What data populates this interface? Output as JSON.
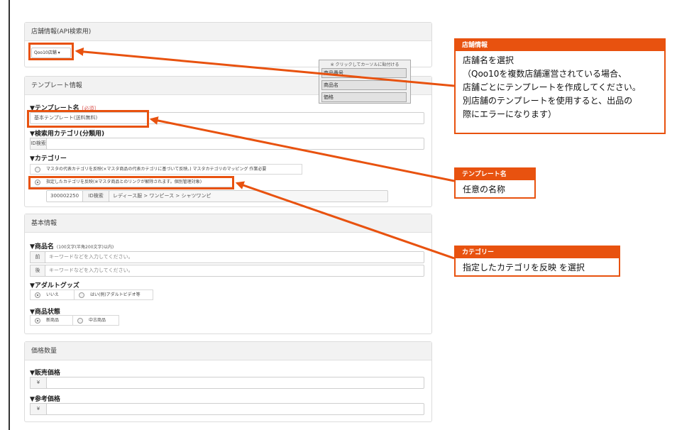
{
  "store_panel": {
    "title": "店舗情報(API検索用)",
    "store_dropdown": "Qoo10店舗 ▾"
  },
  "insert_popup": {
    "note": "※ クリックしてカーソルに貼付ける",
    "items": [
      "商品番号",
      "商品名",
      "価格"
    ]
  },
  "template_panel": {
    "title": "テンプレート情報",
    "template_name_label": "▼テンプレート名",
    "required": "[必須]",
    "template_name_value": "基本テンプレート(送料無料)",
    "search_category_label": "▼検索用カテゴリ(分類用)",
    "id_search": "ID検索",
    "category_label": "▼カテゴリー",
    "category_option_master": "マスタの代表カテゴリを反映(×マスタ商品の代表カテゴリに基づいて反映。) マスタカテゴリのマッピング 作業必要",
    "category_option_specified": "指定したカテゴリを反映(※マスタ商品とのリンクが解除されます。個別管理対象)",
    "category_id": "300002250",
    "category_id_search": "ID検索",
    "category_path": "レディース服 > ワンピース > シャツワンピ"
  },
  "basic_panel": {
    "title": "基本情報",
    "product_name_label": "▼商品名",
    "product_name_hint": "(100文字(半角200文字)以内)",
    "prefix_label": "前",
    "suffix_label": "後",
    "keyword_placeholder": "キーワードなどを入力してください。",
    "adult_label": "▼アダルトグッズ",
    "adult_no": "いいえ",
    "adult_yes": "はい(例)アダルトビデオ等",
    "condition_label": "▼商品状態",
    "condition_new": "新商品",
    "condition_used": "中古商品"
  },
  "price_panel": {
    "title": "価格数量",
    "sale_price_label": "▼販売価格",
    "reference_price_label": "▼参考価格",
    "yen": "¥"
  },
  "callouts": {
    "store": {
      "title": "店舗情報",
      "line1": "店舗名を選択",
      "line2": "（Qoo10を複数店舗運営されている場合、",
      "line3": "店舗ごとにテンプレートを作成してください。",
      "line4": "別店舗のテンプレートを使用すると、出品の",
      "line5": "際にエラーになります）"
    },
    "template": {
      "title": "テンプレート名",
      "body": "任意の名称"
    },
    "category": {
      "title": "カテゴリー",
      "body": "指定したカテゴリを反映 を選択"
    }
  },
  "colors": {
    "accent": "#e8520f",
    "panel_header": "#f2f2f2",
    "border": "#dcdcdc"
  }
}
